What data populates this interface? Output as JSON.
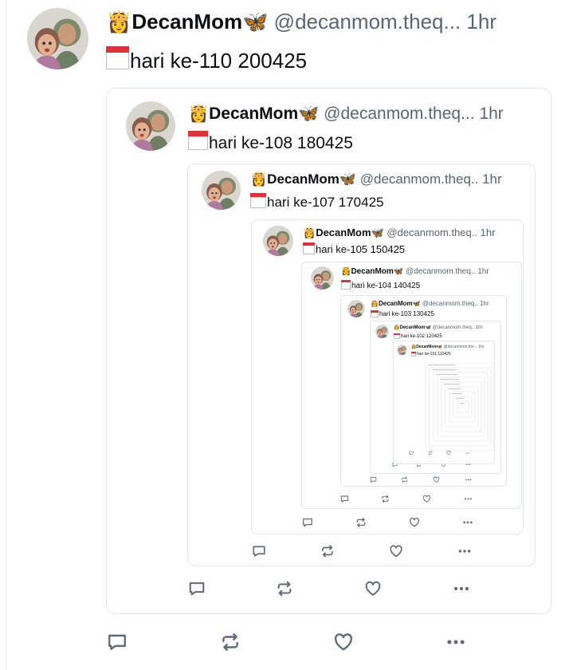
{
  "author": {
    "emoji": "👸",
    "name": "DecanMom",
    "badge": "🦋",
    "handle": "@decanmom.theq...",
    "time": "1hr"
  },
  "posts": [
    {
      "level": 0,
      "handle": "@decanmom.theq...",
      "text": "hari ke-110 200425"
    },
    {
      "level": 1,
      "handle": "@decanmom.theq...",
      "text": "hari ke-108 180425"
    },
    {
      "level": 2,
      "handle": "@decanmom.theq..",
      "text": "hari ke-107 170425"
    },
    {
      "level": 3,
      "handle": "@decanmom.theq..",
      "text": "hari ke-105 150425"
    },
    {
      "level": 4,
      "handle": "@decanmom.theq..",
      "text": "hari ke-104 140425"
    },
    {
      "level": 5,
      "handle": "@decanmom.theq..",
      "text": "hari ke-103 130425"
    },
    {
      "level": 6,
      "handle": "@decanmom.theq..",
      "text": "hari ke-102 120425"
    },
    {
      "level": 7,
      "handle": "@decanmom.the...",
      "text": "hari ke-101 110425"
    }
  ],
  "actions": {
    "reply": "comment-icon",
    "repost": "repost-icon",
    "like": "heart-icon",
    "more": "more-icon"
  },
  "colors": {
    "text": "#0b0f14",
    "muted": "#576574",
    "border": "#e2e6ea",
    "butterfly": "#1d7bf0",
    "calendar": "#e0313b"
  }
}
